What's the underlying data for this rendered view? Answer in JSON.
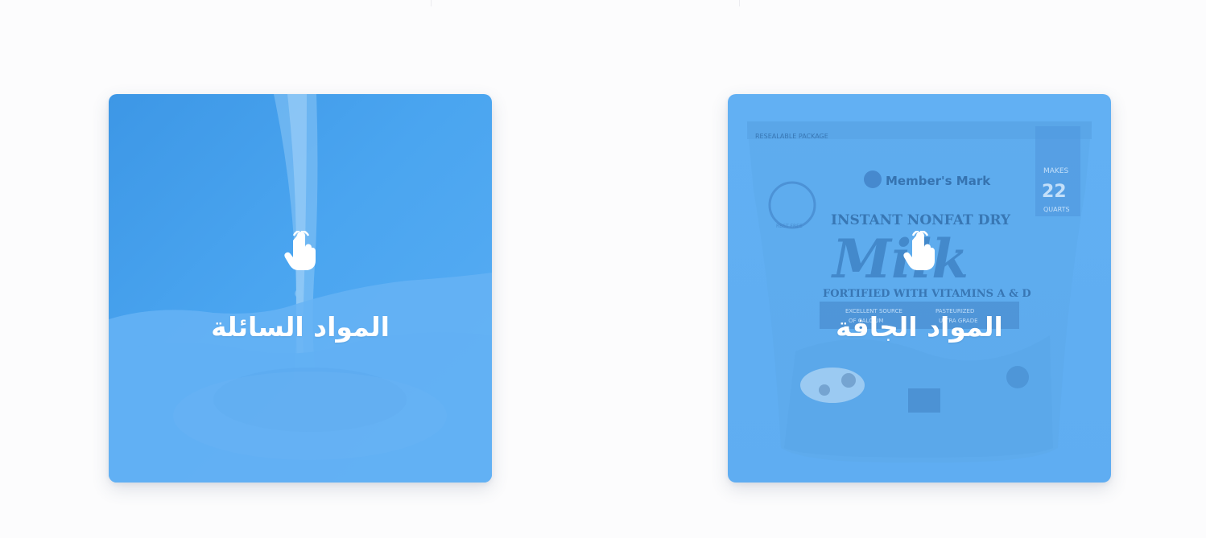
{
  "categories": {
    "liquid": {
      "title": "المواد السائلة",
      "icon": "pointer-hand-icon",
      "image": "milk-pour-photo"
    },
    "dry": {
      "title": "المواد الجافة",
      "icon": "pointer-hand-icon",
      "image": "milk-powder-bag-photo",
      "package_text": {
        "resealable": "RESEALABLE PACKAGE",
        "brand": "Member's Mark",
        "line1": "INSTANT NONFAT DRY",
        "product": "Milk",
        "fortified": "FORTIFIED WITH VITAMINS A & D",
        "makes": "MAKES",
        "quarts": "22",
        "quarts_unit": "QUARTS",
        "excellent": "EXCELLENT SOURCE",
        "calcium": "OF CALCIUM",
        "pasteurized": "PASTEURIZED",
        "ultra": "ULTRA GRADE",
        "badge": "RBST FREE"
      }
    }
  },
  "colors": {
    "card_blue": "#4aa5f0",
    "text": "#ffffff",
    "page_bg": "#fcfcfd"
  }
}
